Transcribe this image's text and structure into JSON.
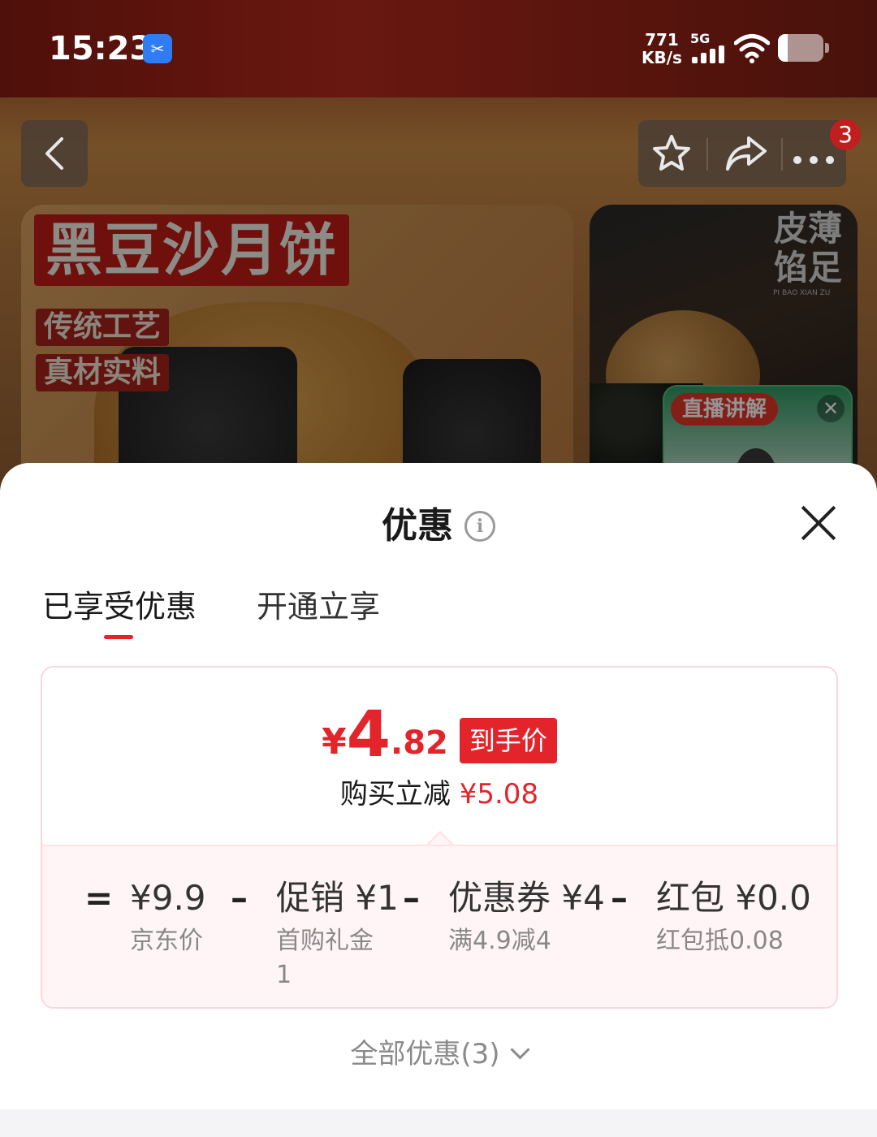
{
  "status_bar": {
    "time": "15:23",
    "net_speed_value": "771",
    "net_speed_unit": "KB/s",
    "network": "5G"
  },
  "nav": {
    "badge_count": "3"
  },
  "product": {
    "main_title": "黑豆沙月饼",
    "tag1": "传统工艺",
    "tag2": "真材实料",
    "side_vertical_text": "皮薄馅足",
    "side_small_text": "PI BAO XIAN ZU",
    "live_label": "直播讲解"
  },
  "sheet": {
    "title": "优惠",
    "tabs": [
      {
        "label": "已享受优惠",
        "active": true
      },
      {
        "label": "开通立享",
        "active": false
      }
    ],
    "final_price": {
      "currency": "¥",
      "integer": "4",
      "decimal": ".82",
      "tag": "到手价"
    },
    "reduction_label": "购买立减",
    "reduction_amount": "¥5.08",
    "breakdown": {
      "eq": "=",
      "items": [
        {
          "main": "¥9.9",
          "note": "京东价"
        },
        {
          "main": "促销 ¥1",
          "note": "首购礼金\n1"
        },
        {
          "main": "优惠券 ¥4",
          "note": "满4.9减4"
        },
        {
          "main": "红包 ¥0.0",
          "note": "红包抵0.08"
        }
      ],
      "minus": "–"
    },
    "all_offers": "全部优惠(3)"
  },
  "colors": {
    "accent": "#e3242b",
    "card_border": "#f8d7df",
    "card_bottom_bg": "#fff5f7"
  }
}
